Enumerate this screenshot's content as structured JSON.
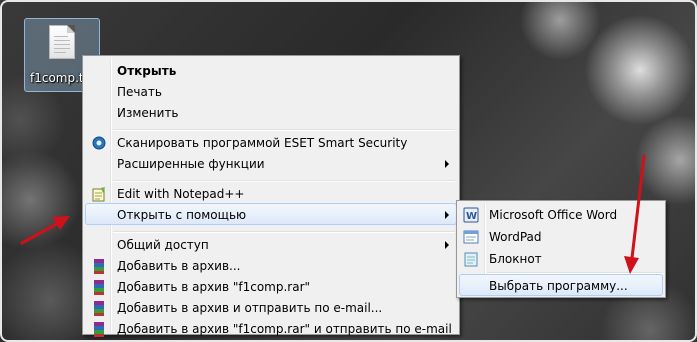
{
  "desktop": {
    "file_name": "f1comp.t"
  },
  "context_menu": {
    "items": [
      {
        "label": "Открыть",
        "bold": true
      },
      {
        "label": "Печать"
      },
      {
        "label": "Изменить"
      },
      {
        "label": "Сканировать программой ESET Smart Security",
        "icon": "eset-icon"
      },
      {
        "label": "Расширенные функции",
        "submenu": true
      },
      {
        "label": "Edit with Notepad++",
        "icon": "notepad-plus-plus-icon"
      },
      {
        "label": "Открыть с помощью",
        "submenu": true,
        "highlighted": true
      },
      {
        "label": "Общий доступ",
        "submenu": true
      },
      {
        "label": "Добавить в архив...",
        "icon": "winrar-icon"
      },
      {
        "label": "Добавить в архив \"f1comp.rar\"",
        "icon": "winrar-icon"
      },
      {
        "label": "Добавить в архив и отправить по e-mail...",
        "icon": "winrar-icon"
      },
      {
        "label": "Добавить в архив \"f1comp.rar\" и отправить по e-mail",
        "icon": "winrar-icon"
      }
    ]
  },
  "submenu": {
    "items": [
      {
        "label": "Microsoft Office Word",
        "icon": "word-icon"
      },
      {
        "label": "WordPad",
        "icon": "wordpad-icon"
      },
      {
        "label": "Блокнот",
        "icon": "notepad-icon"
      },
      {
        "label": "Выбрать программу...",
        "highlighted": true
      }
    ]
  },
  "colors": {
    "menu_bg": "#f0f0f0",
    "highlight_border": "#aecff7",
    "arrow_red": "#d0101a"
  }
}
